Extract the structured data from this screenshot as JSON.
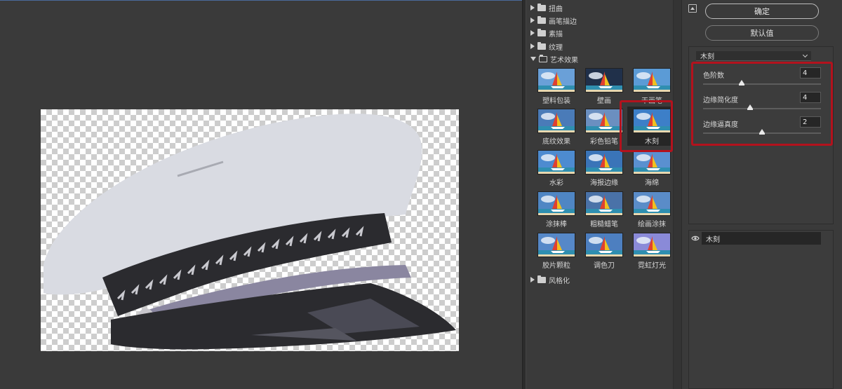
{
  "gallery": {
    "categories_top": [
      {
        "label": "扭曲"
      },
      {
        "label": "画笔描边"
      },
      {
        "label": "素描"
      },
      {
        "label": "纹理"
      }
    ],
    "open_category": {
      "label": "艺术效果"
    },
    "filters": [
      {
        "label": "塑料包装"
      },
      {
        "label": "壁画"
      },
      {
        "label": "干画笔"
      },
      {
        "label": "底纹效果"
      },
      {
        "label": "彩色铅笔"
      },
      {
        "label": "木刻"
      },
      {
        "label": "水彩"
      },
      {
        "label": "海报边缘"
      },
      {
        "label": "海绵"
      },
      {
        "label": "涂抹棒"
      },
      {
        "label": "粗糙蜡笔"
      },
      {
        "label": "绘画涂抹"
      },
      {
        "label": "胶片颗粒"
      },
      {
        "label": "调色刀"
      },
      {
        "label": "霓虹灯光"
      }
    ],
    "selected_filter": "木刻",
    "categories_bottom": [
      {
        "label": "风格化"
      }
    ]
  },
  "settings": {
    "ok_label": "确定",
    "default_label": "默认值",
    "filter_select": "木刻",
    "params": [
      {
        "label": "色阶数",
        "value": "4",
        "fraction": 0.33
      },
      {
        "label": "边缘简化度",
        "value": "4",
        "fraction": 0.4
      },
      {
        "label": "边缘逼真度",
        "value": "2",
        "fraction": 0.5
      }
    ]
  },
  "layers": {
    "items": [
      {
        "label": "木刻"
      }
    ]
  },
  "colors": {
    "highlight": "#b3121d",
    "panel_bg": "#3a3a3a",
    "cap_white": "#d9dbe2",
    "cap_band": "#2b2b2f",
    "cap_braid": "#8a86a0"
  },
  "icons": {
    "collapse": "collapse-arrow-icon",
    "eye": "eye-icon",
    "folder": "folder-icon"
  }
}
